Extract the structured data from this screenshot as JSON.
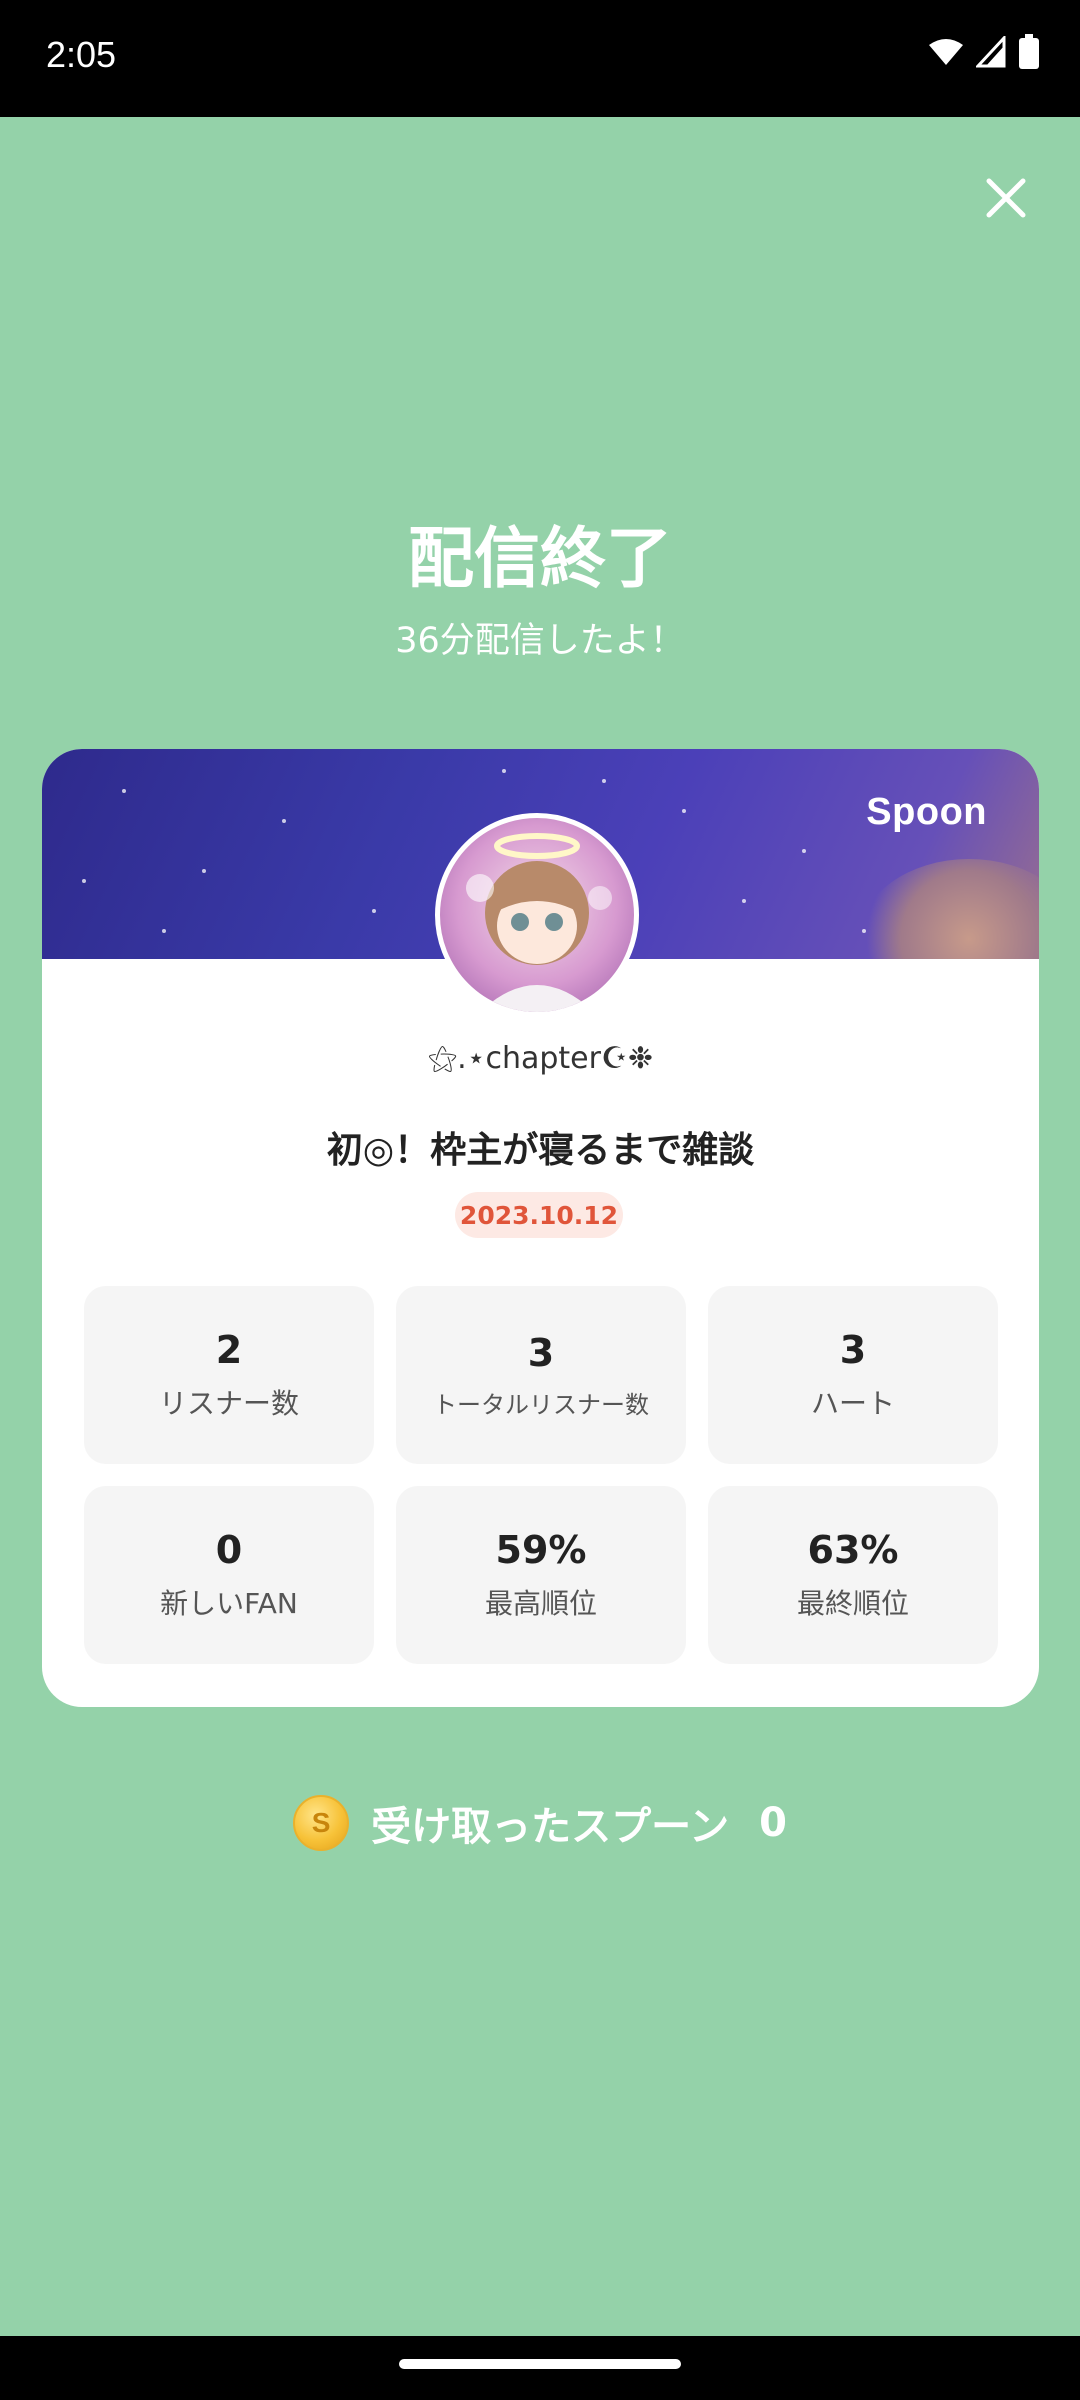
{
  "status_bar": {
    "time": "2:05"
  },
  "header": {
    "title": "配信終了",
    "subtitle": "36分配信したよ！"
  },
  "card": {
    "brand": "Spoon",
    "username": "⚝.⋆chapter☪❉",
    "broadcast_title": "初◎！枠主が寝るまで雑談",
    "date": "2023.10.12",
    "stats": [
      {
        "value": "2",
        "label": "リスナー数"
      },
      {
        "value": "3",
        "label": "トータルリスナー数"
      },
      {
        "value": "3",
        "label": "ハート"
      },
      {
        "value": "0",
        "label": "新しいFAN"
      },
      {
        "value": "59%",
        "label": "最高順位"
      },
      {
        "value": "63%",
        "label": "最終順位"
      }
    ]
  },
  "spoons": {
    "coin_symbol": "S",
    "label": "受け取ったスプーン",
    "count": "0"
  },
  "colors": {
    "background": "#94d2a9",
    "date_text": "#e0553a",
    "date_bg": "#fde9e4"
  }
}
